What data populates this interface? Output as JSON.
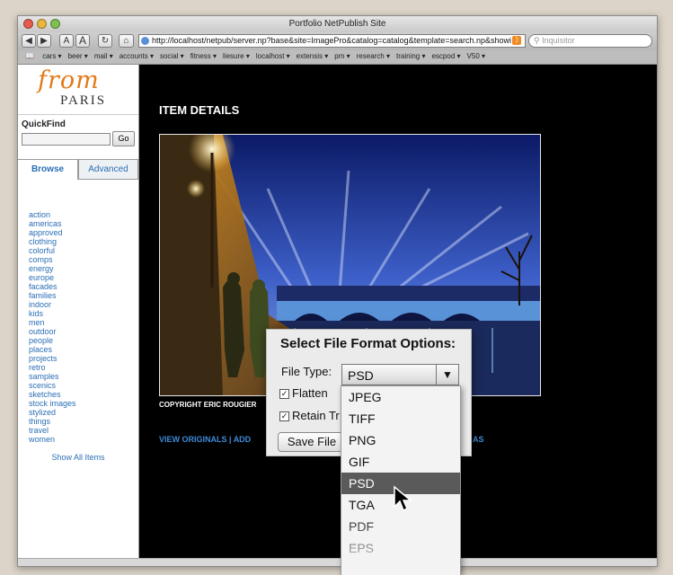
{
  "browser": {
    "window_title": "Portfolio NetPublish Site",
    "url": "http://localhost/netpub/server.np?base&site=ImagePro&catalog=catalog&template=search.np&showi",
    "search_placeholder": "Inquisitor",
    "text_smaller": "A",
    "text_larger": "A",
    "bookmarks": [
      "cars ▾",
      "beer ▾",
      "mail ▾",
      "accounts ▾",
      "social ▾",
      "fitness ▾",
      "liesure ▾",
      "localhost ▾",
      "extensis ▾",
      "pm ▾",
      "research ▾",
      "training ▾",
      "escpod ▾",
      "V50 ▾"
    ]
  },
  "sidebar": {
    "logo_script": "from",
    "logo_sub": "PARIS",
    "quickfind_label": "QuickFind",
    "go_label": "Go",
    "tabs": [
      "Browse",
      "Advanced"
    ],
    "categories": [
      "action",
      "americas",
      "approved",
      "clothing",
      "colorful",
      "comps",
      "energy",
      "europe",
      "facades",
      "families",
      "indoor",
      "kids",
      "men",
      "outdoor",
      "people",
      "places",
      "projects",
      "retro",
      "samples",
      "scenics",
      "sketches",
      "stock images",
      "stylized",
      "things",
      "travel",
      "women"
    ],
    "show_all": "Show All Items"
  },
  "main": {
    "heading": "ITEM DETAILS",
    "copyright": "COPYRIGHT ERIC ROUGIER",
    "actions_left": "VIEW ORIGINALS  |  ADD",
    "actions_right": "AVE AS"
  },
  "dialog": {
    "title": "Select File Format Options:",
    "file_type_label": "File Type:",
    "flatten_label": "Flatten",
    "retain_label": "Retain Tr",
    "save_label": "Save File",
    "selected_type": "PSD",
    "options": [
      "JPEG",
      "TIFF",
      "PNG",
      "GIF",
      "PSD",
      "TGA",
      "PDF",
      "EPS"
    ],
    "highlighted_option": "PSD"
  }
}
